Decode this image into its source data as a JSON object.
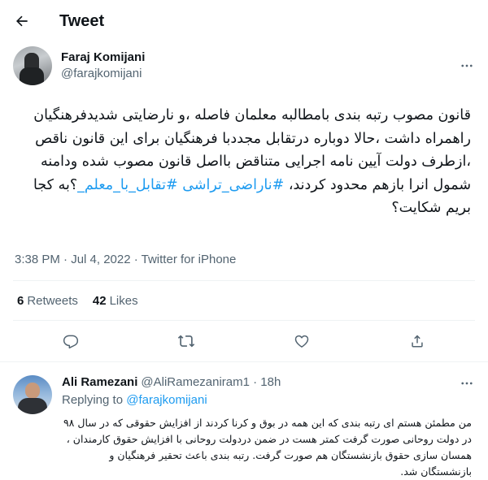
{
  "header": {
    "title": "Tweet"
  },
  "author": {
    "name": "Faraj Komijani",
    "handle": "@farajkomijani"
  },
  "tweet": {
    "text_plain": "قانون مصوب رتبه بندی بامطالبه معلمان فاصله ،و نارضایتی شدیدفرهنگیان راهمراه داشت ،حالا دوباره درتقابل مجددبا فرهنگیان برای این قانون ناقص ،ازطرف دولت آیین نامه اجرایی متناقض بااصل قانون مصوب شده ودامنه شمول انرا بازهم محدود کردند، ",
    "hashtag1": "#ناراضی_تراشی",
    "hashtag2": "#تقابل_با_معلم_",
    "text_tail": "؟به کجا بریم شکایت؟",
    "timestamp": "3:38 PM · Jul 4, 2022 · Twitter for iPhone"
  },
  "stats": {
    "retweets_count": "6",
    "retweets_label": "Retweets",
    "likes_count": "42",
    "likes_label": "Likes"
  },
  "actions": [
    "reply-icon",
    "retweet-icon",
    "like-icon",
    "share-icon"
  ],
  "reply": {
    "name": "Ali Ramezani",
    "handle_time": "@AliRamezaniram1 · 18h",
    "replying_prefix": "Replying to",
    "replying_to": "@farajkomijani",
    "text": "من مطمئن هستم ای رتبه بندی که این همه در بوق و کرنا کردند از افزایش حقوقی که در سال ۹۸ در دولت روحانی صورت گرفت کمتر هست در ضمن دردولت روحانی با افزایش حقوق کارمندان ، همسان سازی حقوق بازنشستگان هم صورت گرفت. رتبه بندی باعث تحقیر فرهنگیان و بازنشستگان شد."
  },
  "colors": {
    "accent": "#1d9bf0",
    "text": "#0f1419",
    "muted": "#536471",
    "divider": "#eff3f4"
  }
}
